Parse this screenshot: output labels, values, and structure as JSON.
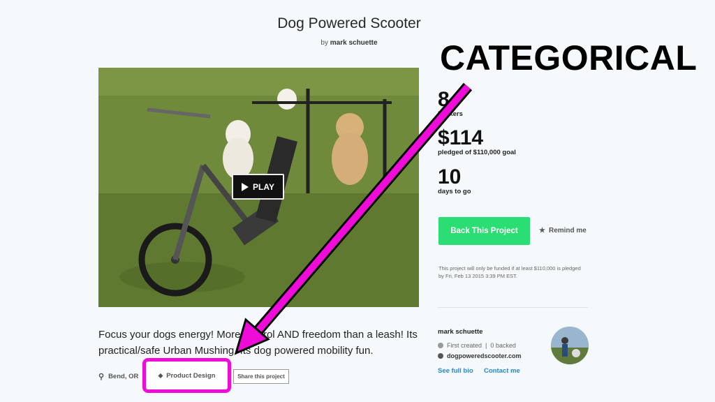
{
  "project": {
    "title": "Dog Powered Scooter",
    "by_prefix": "by",
    "creator": "mark schuette"
  },
  "annotation": {
    "text": "CATEGORICAL",
    "arrow_color": "#ef0cd9"
  },
  "video": {
    "play_label": "PLAY"
  },
  "stats": {
    "backers_num": "8",
    "backers_label": "backers",
    "pledged_num": "$114",
    "pledged_label": "pledged of $110,000 goal",
    "days_num": "10",
    "days_label": "days to go"
  },
  "actions": {
    "back_label": "Back This Project",
    "remind_label": "Remind me",
    "fine_print": "This project will only be funded if at least $110,000 is pledged by Fri, Feb 13 2015 3:39 PM EST.",
    "back_color": "#2bde73"
  },
  "creator_box": {
    "name": "mark schuette",
    "created_text": "First created",
    "backed_text": "0 backed",
    "website": "dogpoweredscooter.com",
    "bio_link": "See full bio",
    "contact_link": "Contact me"
  },
  "blurb": "Focus your dogs energy! More control AND freedom than a leash! Its practical/safe Urban Mushing. Its dog powered mobility fun.",
  "tags": {
    "location": "Bend, OR",
    "category": "Product Design",
    "share": "Share this project"
  }
}
